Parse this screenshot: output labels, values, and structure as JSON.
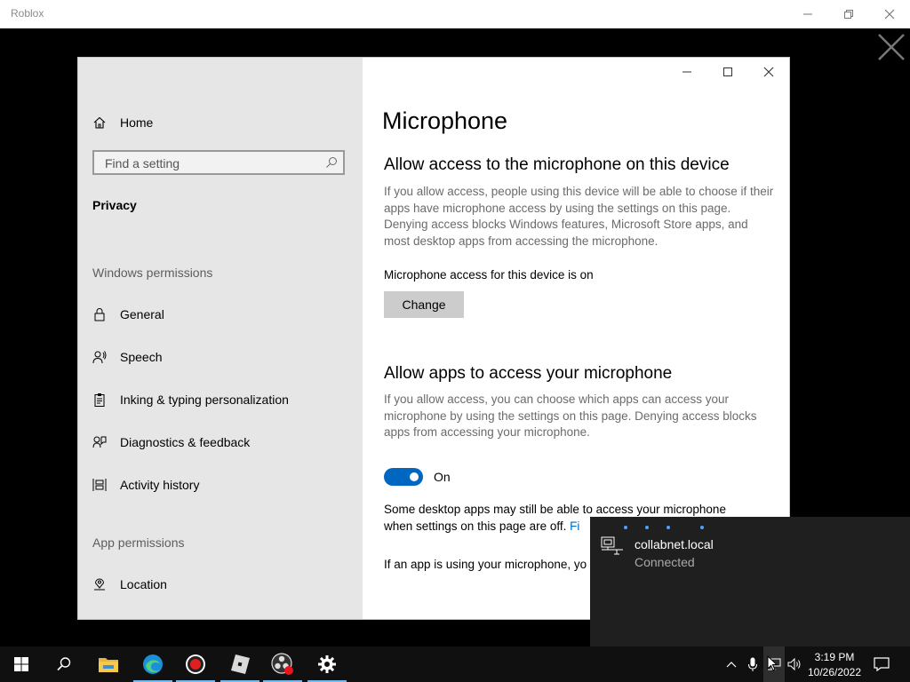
{
  "roblox": {
    "title": "Roblox"
  },
  "settings": {
    "nav": {
      "home": "Home",
      "search_placeholder": "Find a setting",
      "category": "Privacy",
      "section_windows": "Windows permissions",
      "section_app": "App permissions",
      "items": [
        {
          "label": "General",
          "icon": "lock-icon"
        },
        {
          "label": "Speech",
          "icon": "speech-icon"
        },
        {
          "label": "Inking & typing personalization",
          "icon": "clipboard-icon"
        },
        {
          "label": "Diagnostics & feedback",
          "icon": "feedback-icon"
        },
        {
          "label": "Activity history",
          "icon": "timeline-icon"
        }
      ],
      "app_items": [
        {
          "label": "Location",
          "icon": "location-icon"
        }
      ]
    },
    "page_title": "Microphone",
    "device_section": {
      "heading": "Allow access to the microphone on this device",
      "description": "If you allow access, people using this device will be able to choose if their apps have microphone access by using the settings on this page. Denying access blocks Windows features, Microsoft Store apps, and most desktop apps from accessing the microphone.",
      "status": "Microphone access for this device is on",
      "change_button": "Change"
    },
    "apps_section": {
      "heading": "Allow apps to access your microphone",
      "description": "If you allow access, you can choose which apps can access your microphone by using the settings on this page. Denying access blocks apps from accessing your microphone.",
      "toggle_state": "On",
      "note_line1": "Some desktop apps may still be able to access your microphone",
      "note_line2": "when settings on this page are off.",
      "note_link": "Fi",
      "using_text": "If an app is using your microphone, yo"
    }
  },
  "network_flyout": {
    "network_name": "collabnet.local",
    "status": "Connected"
  },
  "taskbar": {
    "time": "3:19 PM",
    "date": "10/26/2022",
    "apps": [
      "start-icon",
      "search-icon",
      "file-explorer-icon",
      "edge-icon",
      "recorder-icon",
      "roblox-icon",
      "obs-icon",
      "settings-icon"
    ]
  },
  "colors": {
    "accent": "#0067c0",
    "nav_bg": "#e6e6e6",
    "flyout_bg": "#1f1f1f",
    "taskbar_bg": "#101010"
  }
}
